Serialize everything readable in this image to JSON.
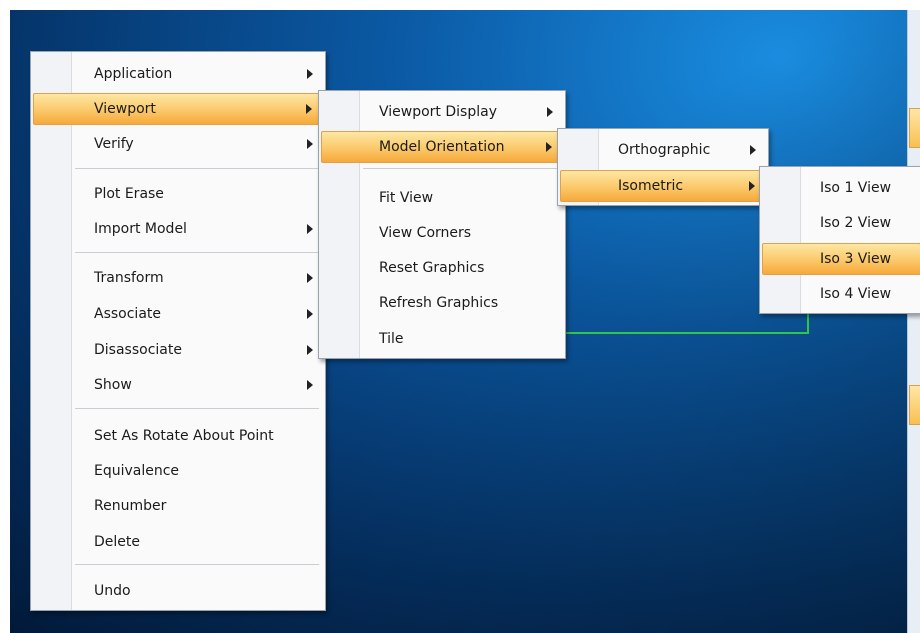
{
  "context_menu": {
    "items": [
      {
        "label": "Application",
        "submenu": true
      },
      {
        "label": "Viewport",
        "submenu": true,
        "highlighted": true
      },
      {
        "label": "Verify",
        "submenu": true
      },
      {
        "label": "Plot Erase",
        "submenu": false
      },
      {
        "label": "Import Model",
        "submenu": true
      },
      {
        "label": "Transform",
        "submenu": true
      },
      {
        "label": "Associate",
        "submenu": true
      },
      {
        "label": "Disassociate",
        "submenu": true
      },
      {
        "label": "Show",
        "submenu": true
      },
      {
        "label": "Set As Rotate About Point",
        "submenu": false
      },
      {
        "label": "Equivalence",
        "submenu": false
      },
      {
        "label": "Renumber",
        "submenu": false
      },
      {
        "label": "Delete",
        "submenu": false
      },
      {
        "label": "Undo",
        "submenu": false
      }
    ]
  },
  "viewport_menu": {
    "items": [
      {
        "label": "Viewport Display",
        "submenu": true
      },
      {
        "label": "Model Orientation",
        "submenu": true,
        "highlighted": true
      },
      {
        "label": "Fit View",
        "submenu": false
      },
      {
        "label": "View Corners",
        "submenu": false
      },
      {
        "label": "Reset Graphics",
        "submenu": false
      },
      {
        "label": "Refresh Graphics",
        "submenu": false
      },
      {
        "label": "Tile",
        "submenu": false
      }
    ]
  },
  "orientation_menu": {
    "items": [
      {
        "label": "Orthographic",
        "submenu": true
      },
      {
        "label": "Isometric",
        "submenu": true,
        "highlighted": true
      }
    ]
  },
  "isometric_menu": {
    "items": [
      {
        "label": "Iso 1 View",
        "submenu": false
      },
      {
        "label": "Iso 2 View",
        "submenu": false
      },
      {
        "label": "Iso 3 View",
        "submenu": false,
        "highlighted": true
      },
      {
        "label": "Iso 4 View",
        "submenu": false
      }
    ]
  },
  "colors": {
    "highlight": "#fbc869",
    "menu_background": "#fafafa",
    "viewport_background": "#0b5aa5",
    "model_line": "#34c44a"
  }
}
